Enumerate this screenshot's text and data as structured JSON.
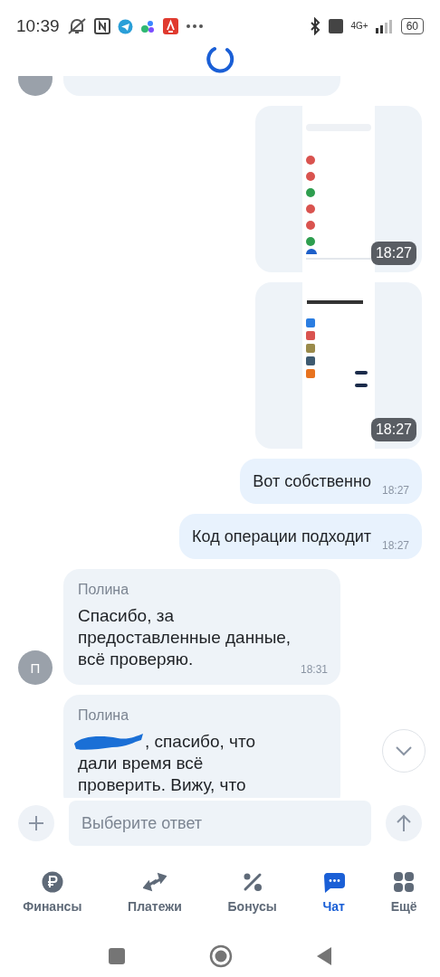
{
  "status_bar": {
    "time": "10:39",
    "network": "4G+",
    "battery": "60"
  },
  "messages": [
    {
      "kind": "partial"
    },
    {
      "time": "18:27"
    },
    {
      "time": "18:27"
    },
    {
      "kind": "outgoing",
      "text": "Вот собственно",
      "time": "18:27"
    },
    {
      "kind": "outgoing",
      "text": "Код операции подходит",
      "time": "18:27"
    },
    {
      "kind": "incoming",
      "sender": "Полина",
      "text": "Спасибо, за предоставленные данные, всё проверяю.",
      "time": "18:31",
      "avatar": "П"
    },
    {
      "kind": "incoming",
      "sender": "Полина",
      "redacted": true,
      "first_line": ", спасибо, что",
      "text": "дали время всё проверить. Вижу, что"
    }
  ],
  "composer": {
    "placeholder": "Выберите ответ"
  },
  "tabs": [
    {
      "label": "Финансы",
      "selected": false
    },
    {
      "label": "Платежи",
      "selected": false
    },
    {
      "label": "Бонусы",
      "selected": false
    },
    {
      "label": "Чат",
      "selected": true
    },
    {
      "label": "Ещё",
      "selected": false
    }
  ]
}
